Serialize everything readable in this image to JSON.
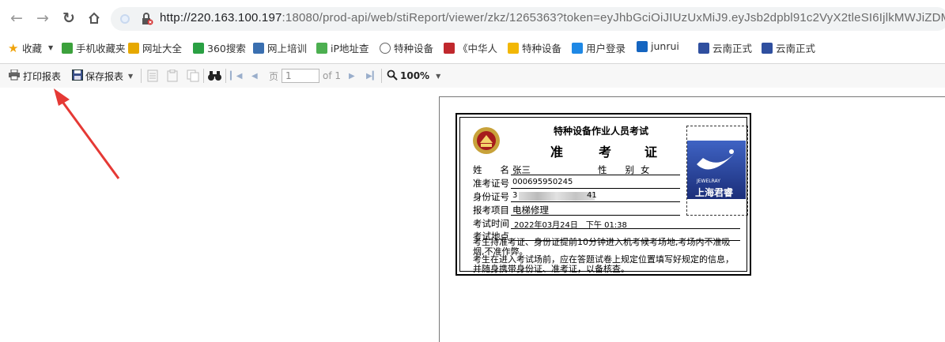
{
  "browser": {
    "url_host": "http://220.163.100.197",
    "url_rest": ":18080/prod-api/web/stiReport/viewer/zkz/1265363?token=eyJhbGciOiJIUzUxMiJ9.eyJsb2dpbl91c2VyX2tleSI6IjlkMWJiZDM0Lm"
  },
  "bookmarks": [
    {
      "label": "收藏",
      "icon": "star-icon",
      "color": "#f0a30a"
    },
    {
      "label": "手机收藏夹",
      "icon": "phone-icon",
      "color": "#3ca13c"
    },
    {
      "label": "网址大全",
      "icon": "site-icon",
      "color": "#e6a800"
    },
    {
      "label": "360搜索",
      "icon": "search-360-icon",
      "color": "#2aa043"
    },
    {
      "label": "网上培训",
      "icon": "training-icon",
      "color": "#3a6fb0"
    },
    {
      "label": "iP地址查",
      "icon": "ip-icon",
      "color": "#4caf50"
    },
    {
      "label": "特种设备",
      "icon": "globe-icon",
      "color": "#666666"
    },
    {
      "label": "《中华人",
      "icon": "book-icon",
      "color": "#c0282d"
    },
    {
      "label": "特种设备",
      "icon": "f-icon",
      "color": "#f2b705"
    },
    {
      "label": "用户登录",
      "icon": "login-icon",
      "color": "#1e88e5"
    },
    {
      "label": "junrui",
      "icon": "dsm-icon",
      "color": "#1565c0"
    },
    {
      "label": "云南正式",
      "icon": "yunnan-icon",
      "color": "#2f4f9f"
    },
    {
      "label": "云南正式",
      "icon": "yunnan-icon",
      "color": "#2f4f9f"
    }
  ],
  "toolbar": {
    "print_label": "打印报表",
    "save_label": "保存报表",
    "page_label": "页",
    "page_value": "1",
    "page_of": "of 1",
    "zoom": "100%"
  },
  "card": {
    "title": "特种设备作业人员考试",
    "subtitle": [
      "准",
      "考",
      "证"
    ],
    "name_label": "姓　　名",
    "name_value": "张三",
    "gender_label": "性　　别",
    "gender_value": "女",
    "exam_no_label": "准考证号",
    "exam_no_value": "000695950245",
    "id_label": "身份证号",
    "id_value_start": "3",
    "id_value_end": "41",
    "item_label": "报考项目",
    "item_value": "电梯修理",
    "time_label": "考试时间",
    "time_value": "2022年03月24日　下午 01:38",
    "place_label": "考试地点",
    "place_value": "",
    "note1": "考生持准考证、身份证提前10分钟进入机考候考场地,考场内不准吸烟,不准作弊。",
    "note2": "考生在进入考试场前，应在答题试卷上规定位置填写好规定的信息，并随身携带身份证、准考证，以备核查。",
    "photo_caption": "上海君睿",
    "photo_brand": "JEWELRAY"
  }
}
